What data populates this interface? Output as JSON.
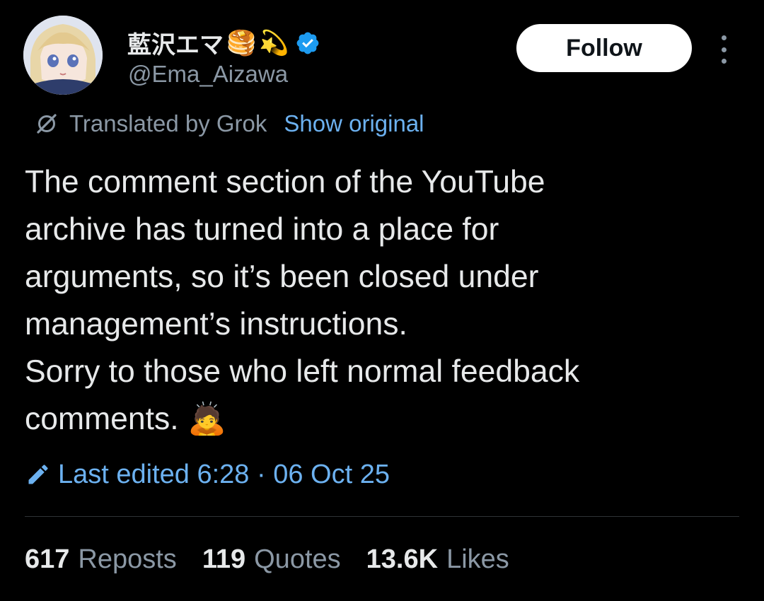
{
  "author": {
    "display_name": "藍沢エマ",
    "name_emojis": [
      "🥞",
      "💫"
    ],
    "handle": "@Ema_Aizawa",
    "verified_icon": "verified-badge-icon",
    "avatar": "avatar-image"
  },
  "header": {
    "follow_label": "Follow",
    "more_icon": "more-vertical-icon"
  },
  "translation": {
    "label": "Translated by Grok",
    "show_original": "Show original",
    "icon": "grok-icon"
  },
  "tweet": {
    "lines": [
      "The comment section of the YouTube",
      "archive has turned into a place for",
      "arguments, so it’s been closed under",
      "management’s instructions.",
      "Sorry to those who left normal feedback",
      "comments."
    ],
    "trailing_emoji": "🙇"
  },
  "edited": {
    "text": "Last edited 6:28 · 06 Oct 25",
    "icon": "pencil-icon"
  },
  "stats": [
    {
      "count": "617",
      "label": "Reposts"
    },
    {
      "count": "119",
      "label": "Quotes"
    },
    {
      "count": "13.6K",
      "label": "Likes"
    }
  ],
  "colors": {
    "background": "#000000",
    "text": "#e7e9ea",
    "muted": "#8b98a5",
    "link": "#6cb1f0",
    "verified": "#1d9bf0",
    "divider": "#2f3336"
  }
}
